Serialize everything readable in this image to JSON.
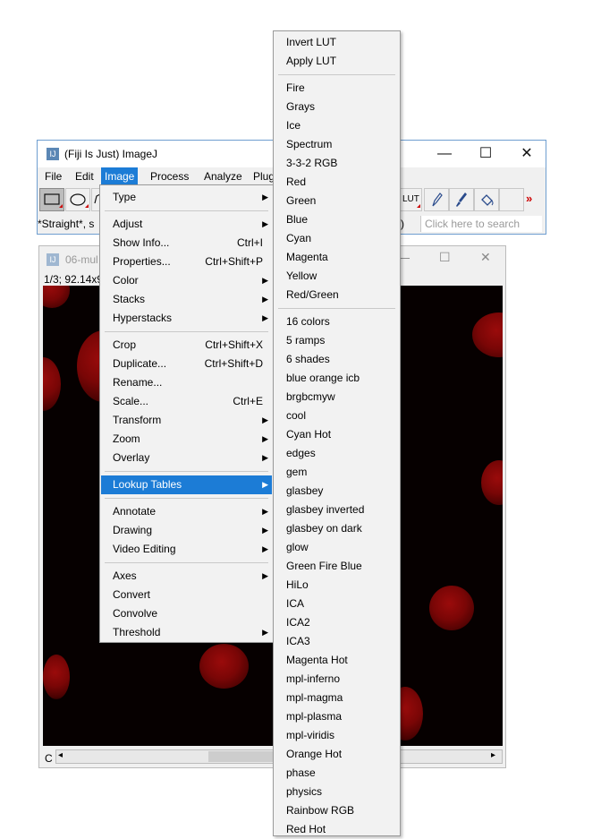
{
  "main_window": {
    "title": "(Fiji Is Just) ImageJ",
    "icon_text": "IJ",
    "minimize_glyph": "—",
    "maximize_glyph": "☐",
    "close_glyph": "✕",
    "menubar": [
      "File",
      "Edit",
      "Image",
      "Process",
      "Analyze",
      "Plug"
    ],
    "status_text": "*Straight*, s",
    "status_tail": ")",
    "lut_label": "LUT",
    "more_tools": "»",
    "search_placeholder": "Click here to search"
  },
  "image_window": {
    "title": "06-mul",
    "info": "1/3; 92.14x9",
    "channel_label": "C",
    "scroll_left": "◂",
    "scroll_right": "▸"
  },
  "image_menu": [
    {
      "label": "Type",
      "submenu": true
    },
    {
      "separator": true
    },
    {
      "label": "Adjust",
      "submenu": true
    },
    {
      "label": "Show Info...",
      "shortcut": "Ctrl+I"
    },
    {
      "label": "Properties...",
      "shortcut": "Ctrl+Shift+P"
    },
    {
      "label": "Color",
      "submenu": true
    },
    {
      "label": "Stacks",
      "submenu": true
    },
    {
      "label": "Hyperstacks",
      "submenu": true
    },
    {
      "separator": true
    },
    {
      "label": "Crop",
      "shortcut": "Ctrl+Shift+X"
    },
    {
      "label": "Duplicate...",
      "shortcut": "Ctrl+Shift+D"
    },
    {
      "label": "Rename..."
    },
    {
      "label": "Scale...",
      "shortcut": "Ctrl+E"
    },
    {
      "label": "Transform",
      "submenu": true
    },
    {
      "label": "Zoom",
      "submenu": true
    },
    {
      "label": "Overlay",
      "submenu": true
    },
    {
      "separator": true
    },
    {
      "label": "Lookup Tables",
      "submenu": true,
      "highlighted": true
    },
    {
      "separator": true
    },
    {
      "label": "Annotate",
      "submenu": true
    },
    {
      "label": "Drawing",
      "submenu": true
    },
    {
      "label": "Video Editing",
      "submenu": true
    },
    {
      "separator": true
    },
    {
      "label": "Axes",
      "submenu": true
    },
    {
      "label": "Convert"
    },
    {
      "label": "Convolve"
    },
    {
      "label": "Threshold",
      "submenu": true
    }
  ],
  "lut_menu": [
    {
      "label": "Invert LUT"
    },
    {
      "label": "Apply LUT"
    },
    {
      "separator": true
    },
    {
      "label": "Fire"
    },
    {
      "label": "Grays"
    },
    {
      "label": "Ice"
    },
    {
      "label": "Spectrum"
    },
    {
      "label": "3-3-2 RGB"
    },
    {
      "label": "Red"
    },
    {
      "label": "Green"
    },
    {
      "label": "Blue"
    },
    {
      "label": "Cyan"
    },
    {
      "label": "Magenta"
    },
    {
      "label": "Yellow"
    },
    {
      "label": "Red/Green"
    },
    {
      "separator": true
    },
    {
      "label": "16 colors"
    },
    {
      "label": "5 ramps"
    },
    {
      "label": "6 shades"
    },
    {
      "label": "blue orange icb"
    },
    {
      "label": "brgbcmyw"
    },
    {
      "label": "cool"
    },
    {
      "label": "Cyan Hot"
    },
    {
      "label": "edges"
    },
    {
      "label": "gem"
    },
    {
      "label": "glasbey"
    },
    {
      "label": "glasbey inverted"
    },
    {
      "label": "glasbey on dark"
    },
    {
      "label": "glow"
    },
    {
      "label": "Green Fire Blue"
    },
    {
      "label": "HiLo"
    },
    {
      "label": "ICA"
    },
    {
      "label": "ICA2"
    },
    {
      "label": "ICA3"
    },
    {
      "label": "Magenta Hot"
    },
    {
      "label": "mpl-inferno"
    },
    {
      "label": "mpl-magma"
    },
    {
      "label": "mpl-plasma"
    },
    {
      "label": "mpl-viridis"
    },
    {
      "label": "Orange Hot"
    },
    {
      "label": "phase"
    },
    {
      "label": "physics"
    },
    {
      "label": "Rainbow RGB"
    },
    {
      "label": "Red Hot"
    }
  ],
  "colors": {
    "highlight": "#1c7cd6",
    "menu_bg": "#f2f2f2",
    "window_border": "#6e9ed0"
  }
}
